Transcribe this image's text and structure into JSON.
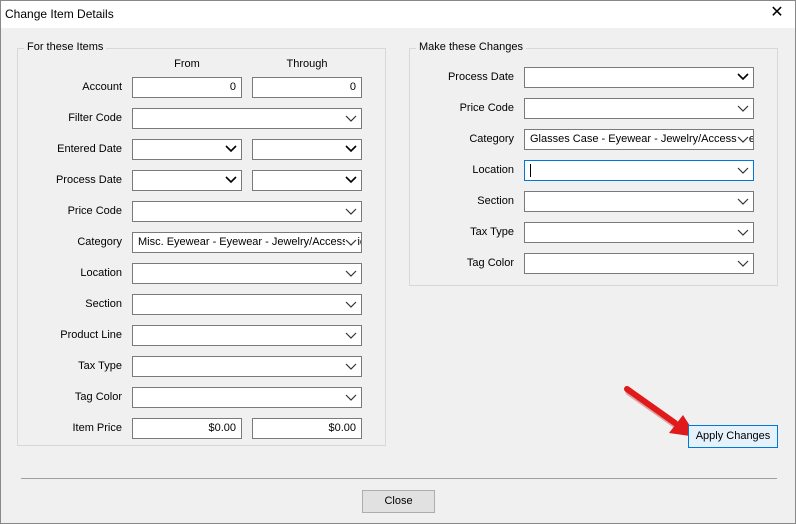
{
  "window": {
    "title": "Change Item Details"
  },
  "left_group": {
    "title": "For these Items",
    "col_from": "From",
    "col_through": "Through",
    "account": {
      "label": "Account",
      "from": "0",
      "through": "0"
    },
    "filter_code": {
      "label": "Filter Code",
      "value": ""
    },
    "entered_date": {
      "label": "Entered Date",
      "from": "",
      "through": ""
    },
    "process_date": {
      "label": "Process Date",
      "from": "",
      "through": ""
    },
    "price_code": {
      "label": "Price Code",
      "value": ""
    },
    "category": {
      "label": "Category",
      "value": "Misc. Eyewear - Eyewear - Jewelry/Accessories"
    },
    "location": {
      "label": "Location",
      "value": ""
    },
    "section": {
      "label": "Section",
      "value": ""
    },
    "product_line": {
      "label": "Product Line",
      "value": ""
    },
    "tax_type": {
      "label": "Tax Type",
      "value": ""
    },
    "tag_color": {
      "label": "Tag Color",
      "value": ""
    },
    "item_price": {
      "label": "Item Price",
      "from": "$0.00",
      "through": "$0.00"
    }
  },
  "right_group": {
    "title": "Make these Changes",
    "process_date": {
      "label": "Process Date",
      "value": ""
    },
    "price_code": {
      "label": "Price Code",
      "value": ""
    },
    "category": {
      "label": "Category",
      "value": "Glasses Case - Eyewear - Jewelry/Accessories"
    },
    "location": {
      "label": "Location",
      "value": ""
    },
    "section": {
      "label": "Section",
      "value": ""
    },
    "tax_type": {
      "label": "Tax Type",
      "value": ""
    },
    "tag_color": {
      "label": "Tag Color",
      "value": ""
    }
  },
  "buttons": {
    "apply": "Apply Changes",
    "close": "Close"
  },
  "colors": {
    "focus_border": "#0078d7",
    "arrow": "#e0191b",
    "dialog_bg": "#f0f0f0"
  }
}
